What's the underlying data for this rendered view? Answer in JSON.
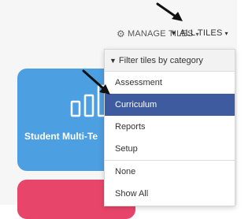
{
  "toolbar": {
    "manage_tiles_label": "MANAGE TILES",
    "all_tiles_label": "ALL TILES",
    "caret": "▾"
  },
  "tiles": {
    "blue_tile_title": "Student Multi-Te",
    "blue_color": "#4c9fe0",
    "red_color": "#e8456a"
  },
  "dropdown": {
    "header": "Filter tiles by category",
    "items": [
      {
        "label": "Assessment",
        "active": false
      },
      {
        "label": "Curriculum",
        "active": true
      },
      {
        "label": "Reports",
        "active": false
      },
      {
        "label": "Setup",
        "active": false
      }
    ],
    "extra_items": [
      {
        "label": "None"
      },
      {
        "label": "Show All"
      }
    ],
    "active_color": "#3f5b9f"
  },
  "icons": {
    "gear": "gear-icon",
    "filter": "filter-icon",
    "chart": "bar-chart-icon",
    "arrow": "pointer-arrow-icon"
  }
}
